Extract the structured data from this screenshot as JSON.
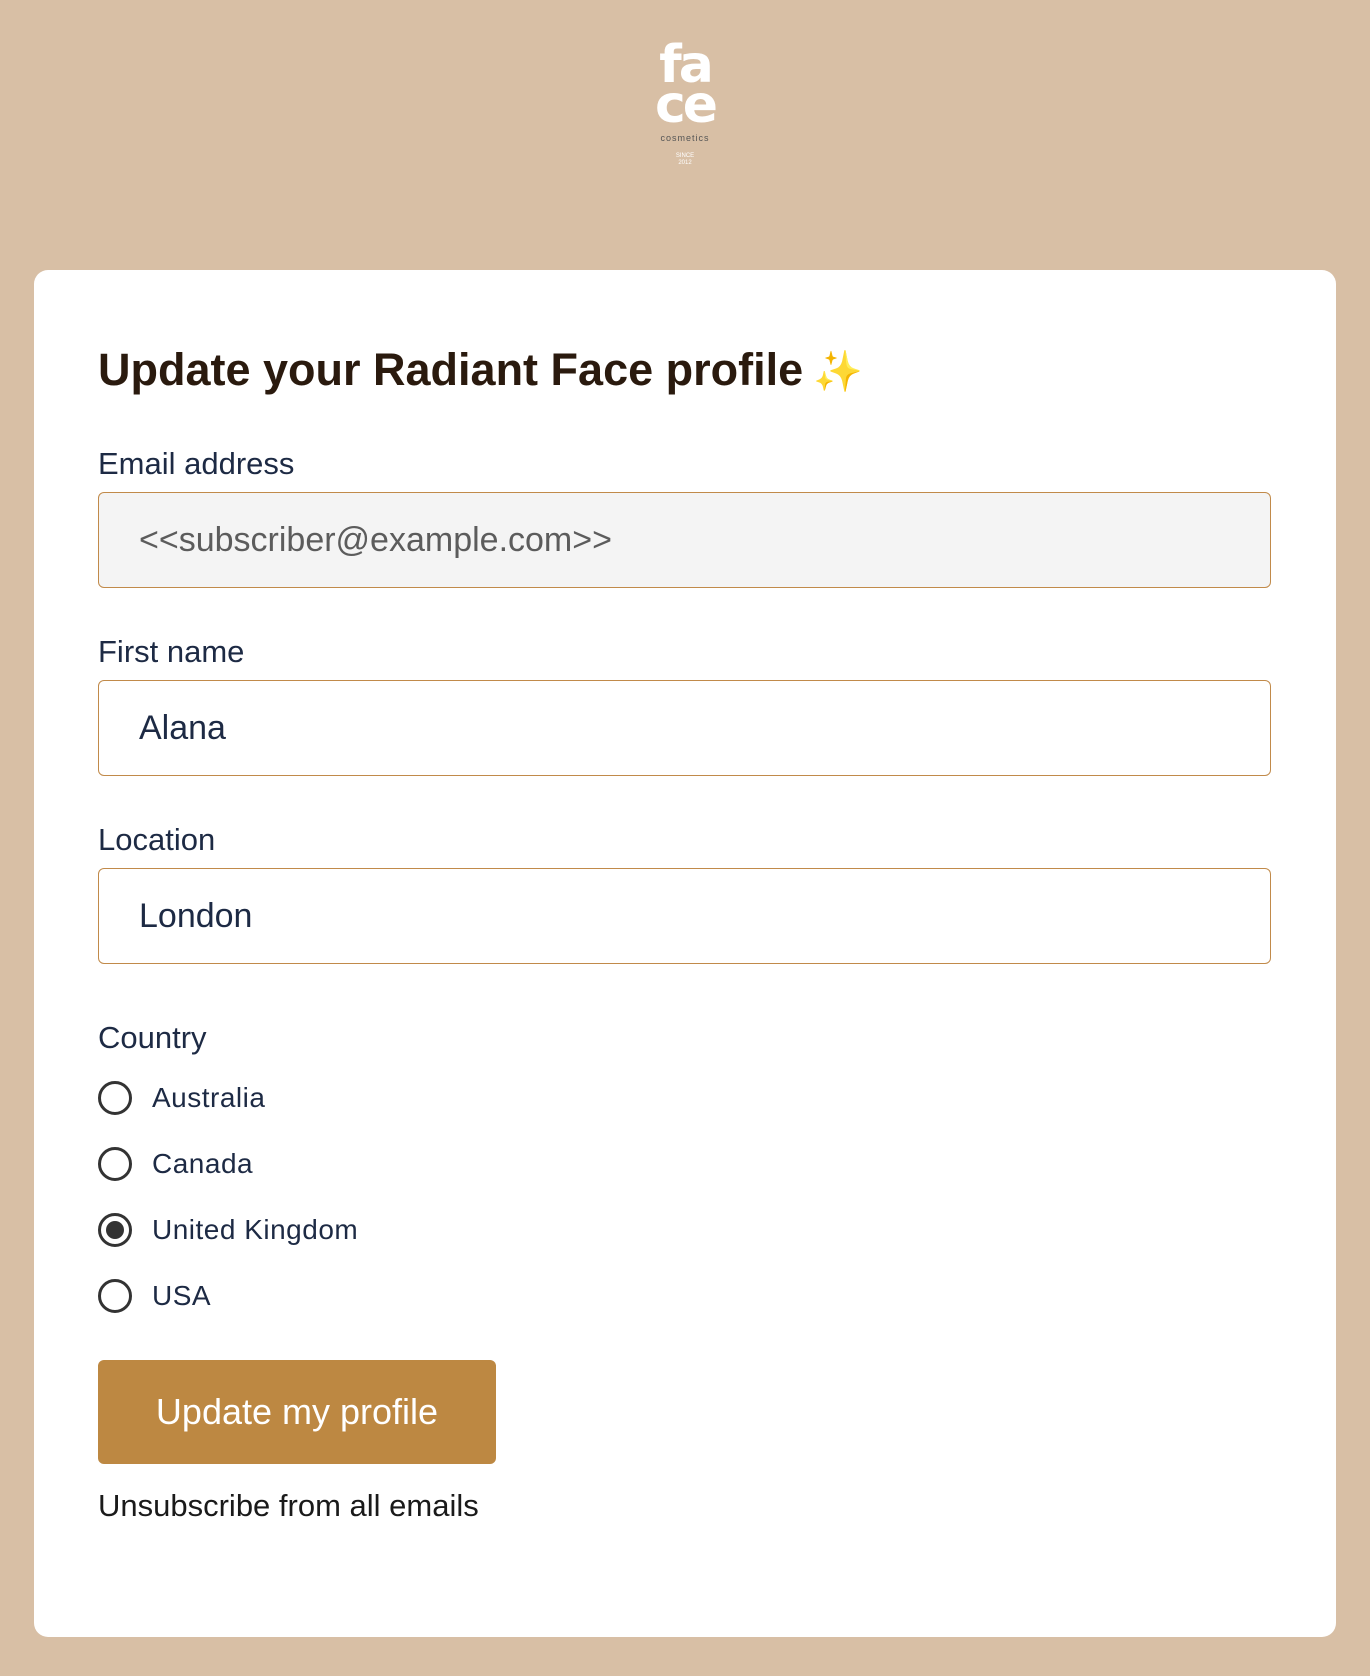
{
  "logo": {
    "mark_top": "fa",
    "mark_bottom": "ce",
    "tagline": "cosmetics",
    "since": "SINCE",
    "year": "2012"
  },
  "form": {
    "title": "Update your Radiant Face profile",
    "title_emoji": "✨",
    "email": {
      "label": "Email address",
      "value": "<<subscriber@example.com>>"
    },
    "first_name": {
      "label": "First name",
      "value": "Alana"
    },
    "location": {
      "label": "Location",
      "value": "London"
    },
    "country": {
      "label": "Country",
      "options": [
        "Australia",
        "Canada",
        "United Kingdom",
        "USA"
      ],
      "selected": "United Kingdom"
    },
    "submit_label": "Update my profile",
    "unsubscribe_label": "Unsubscribe from all emails"
  },
  "colors": {
    "page_background": "#d8bfa5",
    "accent": "#bd8842",
    "input_border": "#c18a4a"
  }
}
